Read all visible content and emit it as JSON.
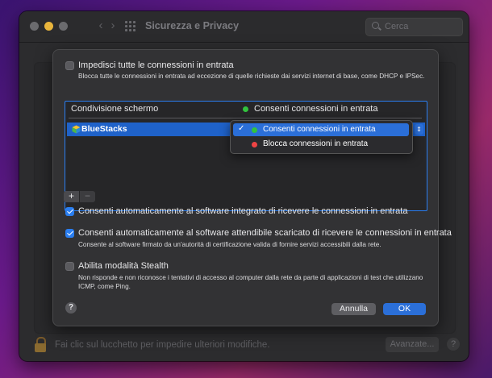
{
  "window": {
    "title": "Sicurezza e Privacy",
    "search_placeholder": "Cerca",
    "footer_text": "Fai clic sul lucchetto per impedire ulteriori modifiche.",
    "advanced_label": "Avanzate...",
    "help_label": "?",
    "nav_back": "‹",
    "nav_forward": "›"
  },
  "sheet": {
    "block_all": {
      "label": "Impedisci tutte le connessioni in entrata",
      "description": "Blocca tutte le connessioni in entrata ad eccezione di quelle richieste dai servizi internet di base, come DHCP e IPSec.",
      "checked": false
    },
    "table": {
      "col1_header": "Condivisione schermo",
      "col2_header": "Consenti connessioni in entrata",
      "col2_dot_color": "#32c33e",
      "rows": [
        {
          "name": "BlueStacks",
          "icon": "bluestacks-icon"
        }
      ],
      "stepper_glyph": "⇕"
    },
    "popup": {
      "items": [
        {
          "check": "✓",
          "label": "Consenti connessioni in entrata",
          "dot_color": "#32c33e",
          "selected": true
        },
        {
          "check": "",
          "label": "Blocca connessioni in entrata",
          "dot_color": "#ef4444",
          "selected": false
        }
      ]
    },
    "add_label": "+",
    "remove_label": "−",
    "auto_builtin": {
      "label": "Consenti automaticamente al software integrato di ricevere le connessioni in entrata",
      "checked": true
    },
    "auto_signed": {
      "label": "Consenti automaticamente al software attendibile scaricato di ricevere le connessioni in entrata",
      "description": "Consente al software firmato da un'autorità di certificazione valida di fornire servizi accessibili dalla rete.",
      "checked": true
    },
    "stealth": {
      "label": "Abilita modalità Stealth",
      "description": "Non risponde e non riconosce i tentativi di accesso al computer dalla rete da parte di applicazioni di test che utilizzano ICMP, come Ping.",
      "checked": false
    },
    "help_label": "?",
    "cancel_label": "Annulla",
    "ok_label": "OK"
  }
}
